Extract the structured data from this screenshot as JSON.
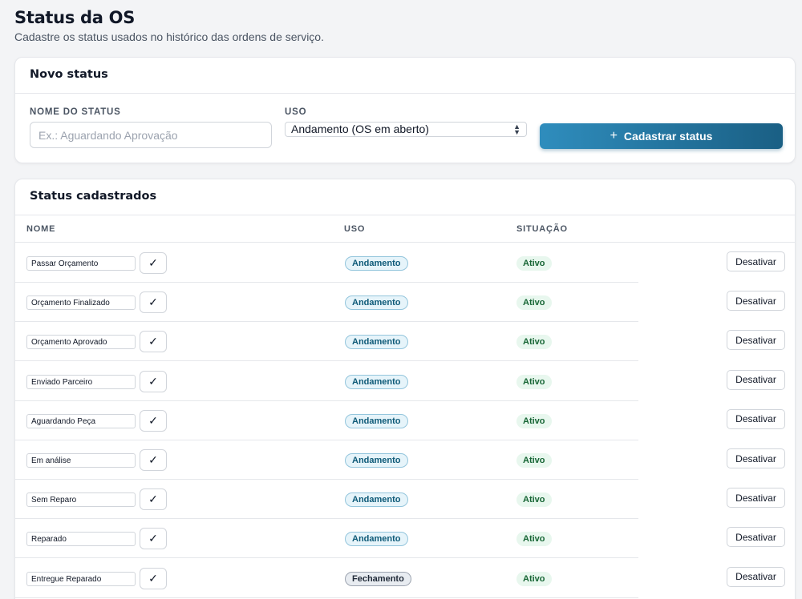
{
  "page": {
    "title": "Status da OS",
    "subtitle": "Cadastre os status usados no histórico das ordens de serviço."
  },
  "new_status": {
    "header": "Novo status",
    "name_label": "NOME DO STATUS",
    "name_placeholder": "Ex.: Aguardando Aprovação",
    "name_value": "",
    "usage_label": "USO",
    "usage_selected": "Andamento (OS em aberto)",
    "submit_label": "Cadastrar status",
    "submit_icon": "plus-icon",
    "accent_start": "#2f8dbd",
    "accent_end": "#1a5f84"
  },
  "status_list": {
    "header": "Status cadastrados",
    "columns": {
      "name": "NOME",
      "usage": "USO",
      "situation": "SITUAÇÃO"
    },
    "rows": [
      {
        "name": "Passar Orçamento",
        "usage": "Andamento",
        "situation": "Ativo",
        "action": "Desativar"
      },
      {
        "name": "Orçamento Finalizado",
        "usage": "Andamento",
        "situation": "Ativo",
        "action": "Desativar"
      },
      {
        "name": "Orçamento Aprovado",
        "usage": "Andamento",
        "situation": "Ativo",
        "action": "Desativar"
      },
      {
        "name": "Enviado Parceiro",
        "usage": "Andamento",
        "situation": "Ativo",
        "action": "Desativar"
      },
      {
        "name": "Aguardando Peça",
        "usage": "Andamento",
        "situation": "Ativo",
        "action": "Desativar"
      },
      {
        "name": "Em análise",
        "usage": "Andamento",
        "situation": "Ativo",
        "action": "Desativar"
      },
      {
        "name": "Sem Reparo",
        "usage": "Andamento",
        "situation": "Ativo",
        "action": "Desativar"
      },
      {
        "name": "Reparado",
        "usage": "Andamento",
        "situation": "Ativo",
        "action": "Desativar"
      },
      {
        "name": "Entregue Reparado",
        "usage": "Fechamento",
        "situation": "Ativo",
        "action": "Desativar"
      }
    ],
    "confirm_icon": "check-icon"
  }
}
